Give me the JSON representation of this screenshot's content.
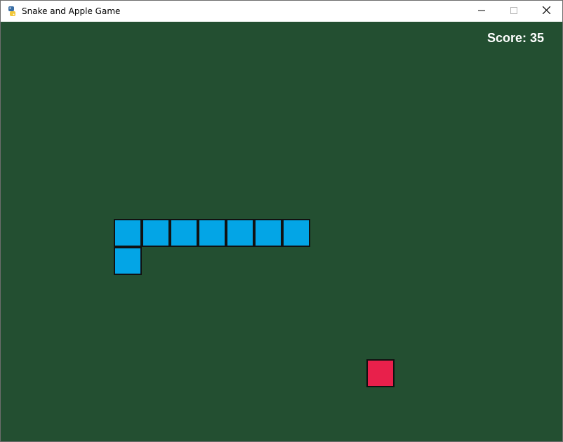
{
  "window": {
    "title": "Snake and Apple Game",
    "app_icon": "python-icon"
  },
  "controls": {
    "minimize_icon": "minimize-icon",
    "maximize_icon": "maximize-icon",
    "close_icon": "close-icon"
  },
  "game": {
    "background_color": "#234f31",
    "grid_cell_size": 40,
    "score_text": "Score: 35",
    "snake": {
      "color": "#03a5e6",
      "segments": [
        {
          "col": 4,
          "row": 7
        },
        {
          "col": 5,
          "row": 7
        },
        {
          "col": 6,
          "row": 7
        },
        {
          "col": 7,
          "row": 7
        },
        {
          "col": 8,
          "row": 7
        },
        {
          "col": 9,
          "row": 7
        },
        {
          "col": 10,
          "row": 7
        },
        {
          "col": 4,
          "row": 8
        }
      ]
    },
    "apple": {
      "color": "#e8204b",
      "col": 13,
      "row": 12
    }
  }
}
